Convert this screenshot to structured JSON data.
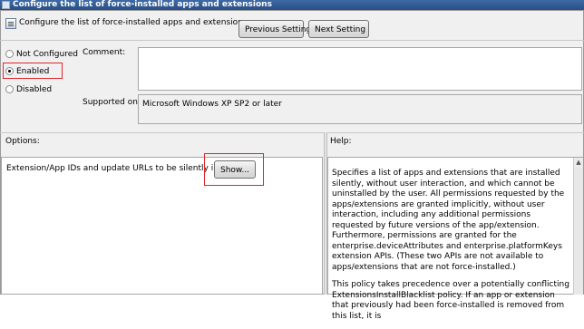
{
  "window": {
    "title": "Configure the list of force-installed apps and extensions"
  },
  "header": {
    "policy_name": "Configure the list of force-installed apps and extensions"
  },
  "buttons": {
    "previous": "Previous Setting",
    "next": "Next Setting",
    "show": "Show..."
  },
  "state": {
    "options": [
      "Not Configured",
      "Enabled",
      "Disabled"
    ],
    "selected": "Enabled"
  },
  "comment": {
    "label": "Comment:",
    "value": ""
  },
  "supported": {
    "label": "Supported on:",
    "value": "Microsoft Windows XP SP2 or later"
  },
  "options_panel": {
    "label": "Options:",
    "item_label": "Extension/App IDs and update URLs to be silently installed"
  },
  "help_panel": {
    "label": "Help:",
    "paragraphs": [
      "Specifies a list of apps and extensions that are installed silently, without user interaction, and which cannot be uninstalled by the user. All permissions requested by the apps/extensions are granted implicitly, without user interaction, including any additional permissions requested by future versions of the app/extension. Furthermore, permissions are granted for the enterprise.deviceAttributes and enterprise.platformKeys extension APIs. (These two APIs are not available to apps/extensions that are not force-installed.)",
      "This policy takes precedence over a potentially conflicting ExtensionsInstallBlacklist policy. If an app or extension that previously had been force-installed is removed from this list, it is"
    ]
  },
  "highlight_color": "#e0262d"
}
